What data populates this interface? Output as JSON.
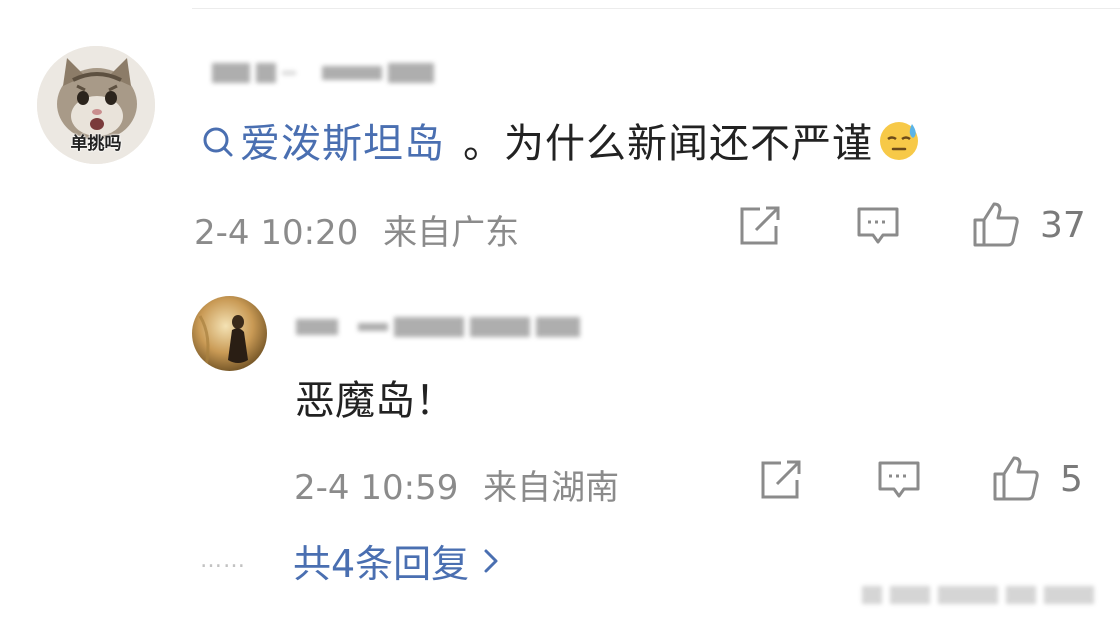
{
  "comment": {
    "avatar_caption": "单挑吗",
    "topic": "爱泼斯坦岛",
    "text": "。为什么新闻还不严谨",
    "emoji": "sweat-face-emoji",
    "time": "2-4 10:20",
    "location": "来自广东",
    "like_count": "37",
    "icons": {
      "share": "share-icon",
      "reply": "comment-icon",
      "like": "thumbs-up-icon"
    }
  },
  "reply": {
    "text": "恶魔岛！",
    "time": "2-4 10:59",
    "location": "来自湖南",
    "like_count": "5"
  },
  "more_replies": {
    "dots": "……",
    "label": "共4条回复"
  },
  "colors": {
    "link": "#4a6fb1",
    "text": "#222222",
    "meta": "#8b8b8b",
    "icon": "#7a7a7a"
  }
}
